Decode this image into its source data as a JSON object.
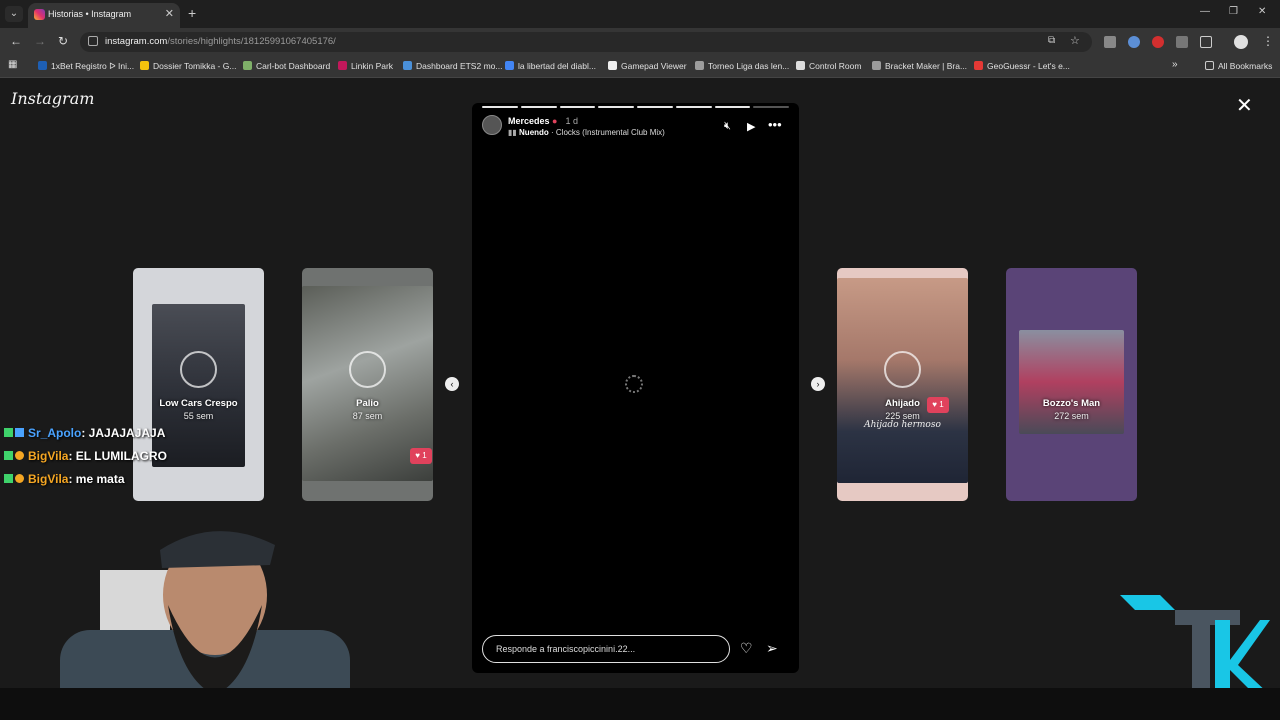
{
  "browser": {
    "tab_title": "Historias • Instagram",
    "url_host": "instagram.com",
    "url_path": "/stories/highlights/18125991067405176/",
    "all_bookmarks_label": "All Bookmarks",
    "bookmarks": [
      {
        "label": "1xBet Registro ᐅ Ini...",
        "color": "#1e5fb4"
      },
      {
        "label": "Dossier Tomikka - G...",
        "color": "#f4c20d"
      },
      {
        "label": "Carl-bot Dashboard",
        "color": "#7fb069"
      },
      {
        "label": "Linkin Park",
        "color": "#c2185b"
      },
      {
        "label": "Dashboard ETS2 mo...",
        "color": "#4a90d9"
      },
      {
        "label": "la libertad del diabl...",
        "color": "#4285f4"
      },
      {
        "label": "Gamepad Viewer",
        "color": "#eeeeee"
      },
      {
        "label": "Torneo Liga das len...",
        "color": "#9c9c9c"
      },
      {
        "label": "Control Room",
        "color": "#dddddd"
      },
      {
        "label": "Bracket Maker | Bra...",
        "color": "#9c9c9c"
      },
      {
        "label": "GeoGuessr - Let's e...",
        "color": "#e53935"
      }
    ]
  },
  "instagram": {
    "logo": "Instagram",
    "story": {
      "username": "Mercedes",
      "time": "1 d",
      "music_artist": "Nuendo",
      "music_track": " · Clocks (Instrumental Club Mix)",
      "reply_placeholder": "Responde a franciscopiccinini.22...",
      "progress_total": 8,
      "progress_current": 7
    },
    "side_stories": [
      {
        "name": "Low Cars Crespo",
        "age": "55 sem"
      },
      {
        "name": "Palio",
        "age": "87 sem",
        "likes": "1"
      },
      {
        "name": "Ahijado",
        "age": "225 sem",
        "likes": "1",
        "caption": "Ahijado hermoso"
      },
      {
        "name": "Bozzo's Man",
        "age": "272 sem"
      }
    ]
  },
  "chat": [
    {
      "user": "Sr_Apolo",
      "message": ": JAJAJAJAJA"
    },
    {
      "user": "BigVila",
      "message": ": EL LUMILAGRO"
    },
    {
      "user": "BigVila",
      "message": ": me mata"
    }
  ]
}
